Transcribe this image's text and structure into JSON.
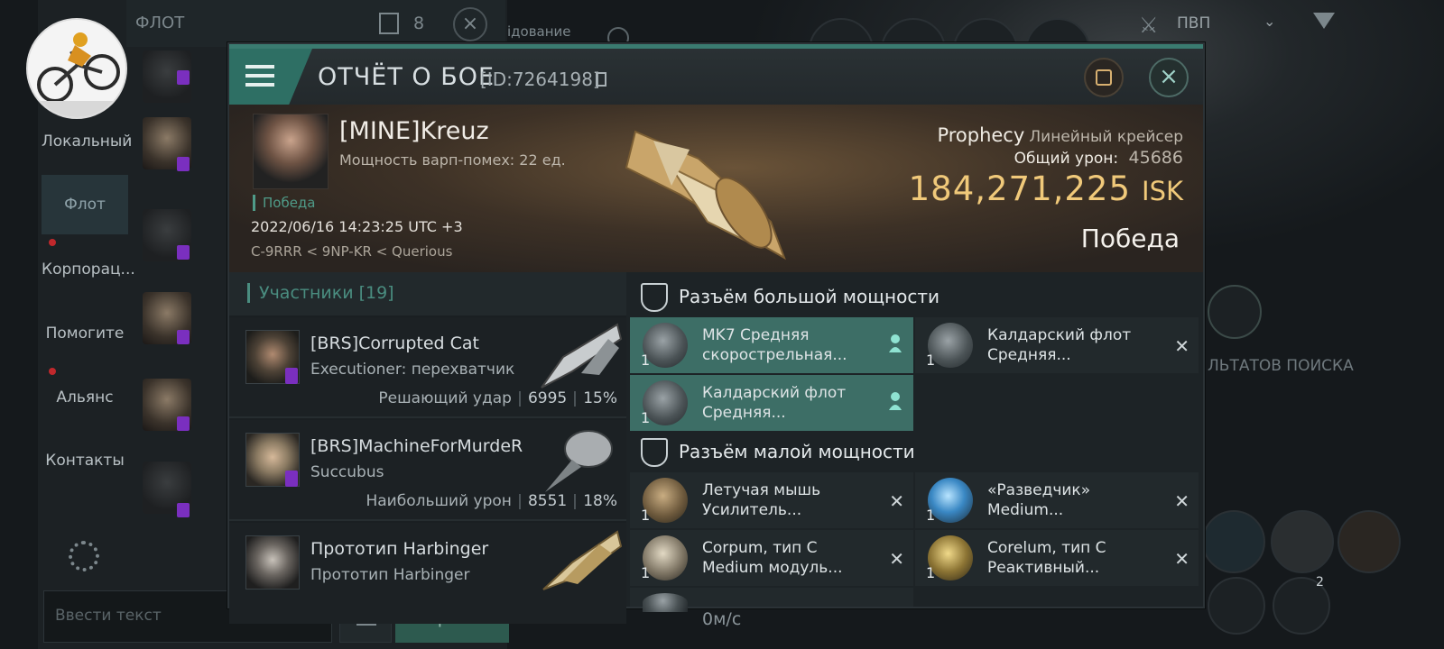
{
  "background": {
    "fleet_title": "ФЛОТ",
    "fleet_count": "8",
    "equipment_label": "ідование",
    "pvp_label": "ПВП",
    "side_tabs": [
      "Локальный",
      "Флот",
      "Корпорац...",
      "Помогите",
      "Альянс",
      "Контакты"
    ],
    "input_placeholder": "Ввести текст",
    "send_label": "Отправить",
    "speed": "0м/с",
    "search_hint": "ЛЬТАТОВ ПОИСКА",
    "badge_count": "2"
  },
  "report": {
    "title": "ОТЧЁТ О БОЕ",
    "report_id": "[ID:7264198]",
    "victim_name": "[MINE]Kreuz",
    "warp_strength": "Мощность варп-помех: 22 ед.",
    "result_tag": "Победа",
    "datetime": "2022/06/16 14:23:25 UTC +3",
    "location": "C-9RRR < 9NP-KR < Querious",
    "ship_name": "Prophecy",
    "ship_class": "Линейный крейсер",
    "total_damage_label": "Общий урон:",
    "total_damage": "45686",
    "isk_value": "184,271,225",
    "isk_unit": "ISK",
    "result": "Победа"
  },
  "participants": {
    "header": "Участники [19]",
    "rows": [
      {
        "name": "[BRS]Corrupted Cat",
        "ship": "Executioner: перехватчик",
        "role": "Решающий удар",
        "damage": "6995",
        "percent": "15%"
      },
      {
        "name": "[BRS]MachineForMurdeR",
        "ship": "Succubus",
        "role": "Наибольший урон",
        "damage": "8551",
        "percent": "18%"
      },
      {
        "name": "Прототип Harbinger",
        "ship": "Прототип Harbinger"
      }
    ]
  },
  "slots": {
    "high_title": "Разъём большой мощности",
    "high": [
      {
        "qty": "1",
        "line1": "MK7 Средняя",
        "line2": "скорострельная..."
      },
      {
        "qty": "1",
        "line1": "Калдарский флот",
        "line2": "Средняя..."
      },
      {
        "qty": "1",
        "line1": "Калдарский флот",
        "line2": "Средняя..."
      }
    ],
    "low_title": "Разъём малой мощности",
    "low": [
      {
        "qty": "1",
        "line1": "Летучая мышь",
        "line2": "Усилитель..."
      },
      {
        "qty": "1",
        "line1": "«Разведчик»",
        "line2": "Medium..."
      },
      {
        "qty": "1",
        "line1": "Corpum, тип C",
        "line2": "Medium модуль..."
      },
      {
        "qty": "1",
        "line1": "Corelum, тип C",
        "line2": "Реактивный..."
      }
    ]
  },
  "colors": {
    "accent": "#3a7b70",
    "isk": "#f0c97a",
    "victory": "#4f9b88",
    "badge": "#7a2fbf"
  }
}
